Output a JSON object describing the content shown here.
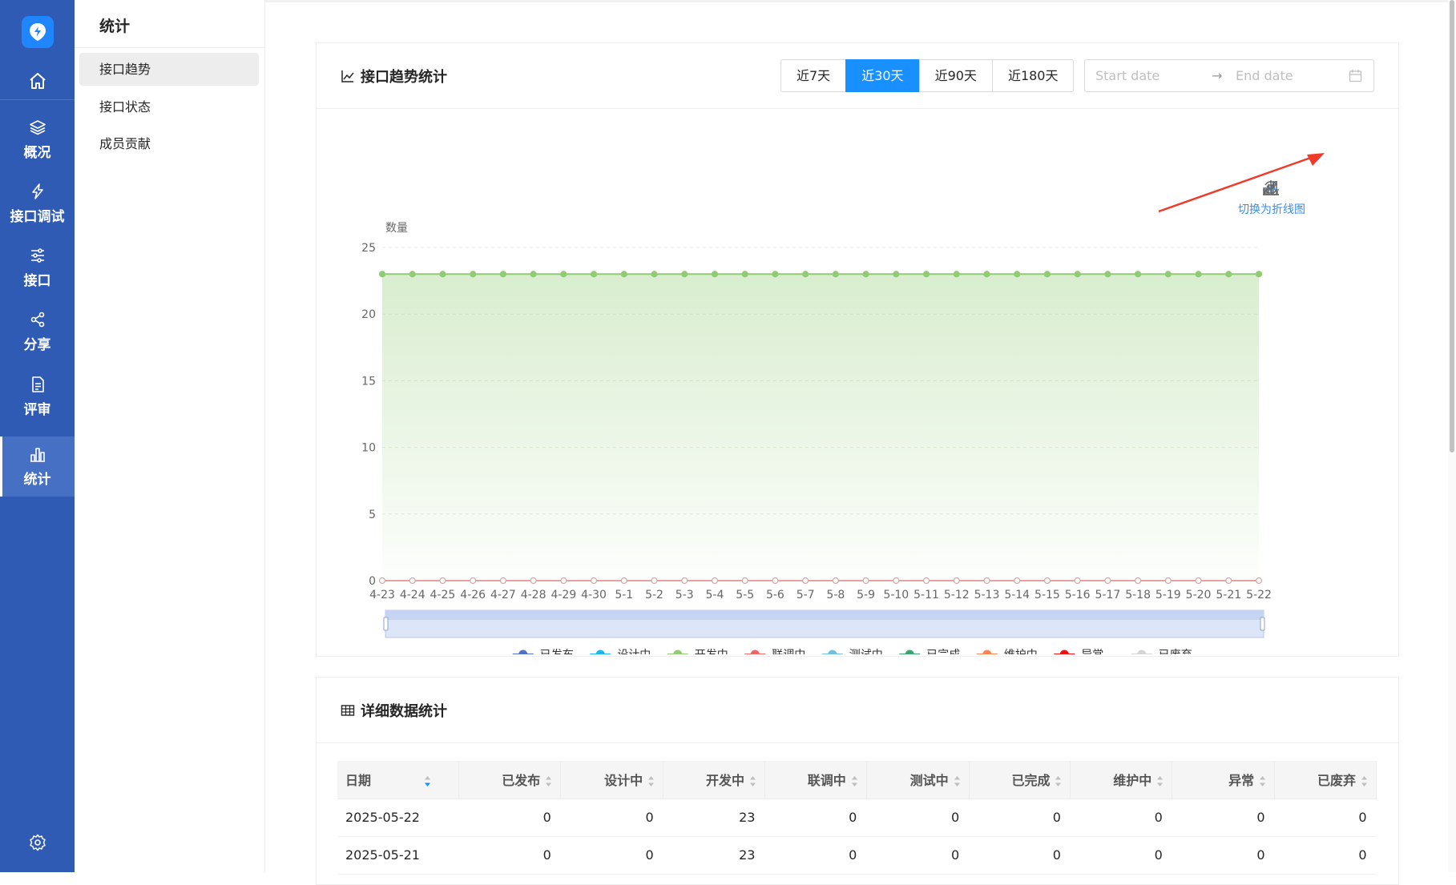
{
  "rail": {
    "items": [
      {
        "name": "home",
        "label": ""
      },
      {
        "name": "overview",
        "label": "概况"
      },
      {
        "name": "api-debug",
        "label": "接口调试"
      },
      {
        "name": "api",
        "label": "接口"
      },
      {
        "name": "share",
        "label": "分享"
      },
      {
        "name": "review",
        "label": "评审"
      },
      {
        "name": "stats",
        "label": "统计"
      }
    ]
  },
  "submenu": {
    "title": "统计",
    "items": [
      "接口趋势",
      "接口状态",
      "成员贡献"
    ]
  },
  "trend_card": {
    "title": "接口趋势统计",
    "ranges": [
      "近7天",
      "近30天",
      "近90天",
      "近180天"
    ],
    "active_range": "近30天",
    "date_start_placeholder": "Start date",
    "date_end_placeholder": "End date",
    "date_separator": "→",
    "toolbox_tip": "切换为折线图"
  },
  "chart_data": {
    "type": "area",
    "title": "",
    "xlabel": "",
    "ylabel": "数量",
    "ylim": [
      0,
      25
    ],
    "yticks": [
      0,
      5,
      10,
      15,
      20,
      25
    ],
    "grid": true,
    "legend_position": "bottom",
    "categories": [
      "4-23",
      "4-24",
      "4-25",
      "4-26",
      "4-27",
      "4-28",
      "4-29",
      "4-30",
      "5-1",
      "5-2",
      "5-3",
      "5-4",
      "5-5",
      "5-6",
      "5-7",
      "5-8",
      "5-9",
      "5-10",
      "5-11",
      "5-12",
      "5-13",
      "5-14",
      "5-15",
      "5-16",
      "5-17",
      "5-18",
      "5-19",
      "5-20",
      "5-21",
      "5-22"
    ],
    "series": [
      {
        "name": "已发布",
        "color": "#5470c6",
        "values": [
          0,
          0,
          0,
          0,
          0,
          0,
          0,
          0,
          0,
          0,
          0,
          0,
          0,
          0,
          0,
          0,
          0,
          0,
          0,
          0,
          0,
          0,
          0,
          0,
          0,
          0,
          0,
          0,
          0,
          0
        ]
      },
      {
        "name": "设计中",
        "color": "#19b7f0",
        "values": [
          0,
          0,
          0,
          0,
          0,
          0,
          0,
          0,
          0,
          0,
          0,
          0,
          0,
          0,
          0,
          0,
          0,
          0,
          0,
          0,
          0,
          0,
          0,
          0,
          0,
          0,
          0,
          0,
          0,
          0
        ]
      },
      {
        "name": "开发中",
        "color": "#91cc75",
        "values": [
          23,
          23,
          23,
          23,
          23,
          23,
          23,
          23,
          23,
          23,
          23,
          23,
          23,
          23,
          23,
          23,
          23,
          23,
          23,
          23,
          23,
          23,
          23,
          23,
          23,
          23,
          23,
          23,
          23,
          23
        ]
      },
      {
        "name": "联调中",
        "color": "#ee6666",
        "values": [
          0,
          0,
          0,
          0,
          0,
          0,
          0,
          0,
          0,
          0,
          0,
          0,
          0,
          0,
          0,
          0,
          0,
          0,
          0,
          0,
          0,
          0,
          0,
          0,
          0,
          0,
          0,
          0,
          0,
          0
        ]
      },
      {
        "name": "测试中",
        "color": "#73c0de",
        "values": [
          0,
          0,
          0,
          0,
          0,
          0,
          0,
          0,
          0,
          0,
          0,
          0,
          0,
          0,
          0,
          0,
          0,
          0,
          0,
          0,
          0,
          0,
          0,
          0,
          0,
          0,
          0,
          0,
          0,
          0
        ]
      },
      {
        "name": "已完成",
        "color": "#3ba272",
        "values": [
          0,
          0,
          0,
          0,
          0,
          0,
          0,
          0,
          0,
          0,
          0,
          0,
          0,
          0,
          0,
          0,
          0,
          0,
          0,
          0,
          0,
          0,
          0,
          0,
          0,
          0,
          0,
          0,
          0,
          0
        ]
      },
      {
        "name": "维护中",
        "color": "#fc8452",
        "values": [
          0,
          0,
          0,
          0,
          0,
          0,
          0,
          0,
          0,
          0,
          0,
          0,
          0,
          0,
          0,
          0,
          0,
          0,
          0,
          0,
          0,
          0,
          0,
          0,
          0,
          0,
          0,
          0,
          0,
          0
        ]
      },
      {
        "name": "异常",
        "color": "#ee1111",
        "values": [
          0,
          0,
          0,
          0,
          0,
          0,
          0,
          0,
          0,
          0,
          0,
          0,
          0,
          0,
          0,
          0,
          0,
          0,
          0,
          0,
          0,
          0,
          0,
          0,
          0,
          0,
          0,
          0,
          0,
          0
        ]
      },
      {
        "name": "已废弃",
        "color": "#d5d5d5",
        "values": [
          0,
          0,
          0,
          0,
          0,
          0,
          0,
          0,
          0,
          0,
          0,
          0,
          0,
          0,
          0,
          0,
          0,
          0,
          0,
          0,
          0,
          0,
          0,
          0,
          0,
          0,
          0,
          0,
          0,
          0
        ]
      }
    ]
  },
  "detail_card": {
    "title": "详细数据统计",
    "columns": [
      "日期",
      "已发布",
      "设计中",
      "开发中",
      "联调中",
      "测试中",
      "已完成",
      "维护中",
      "异常",
      "已废弃"
    ],
    "rows": [
      [
        "2025-05-22",
        "0",
        "0",
        "23",
        "0",
        "0",
        "0",
        "0",
        "0",
        "0"
      ],
      [
        "2025-05-21",
        "0",
        "0",
        "23",
        "0",
        "0",
        "0",
        "0",
        "0",
        "0"
      ]
    ]
  },
  "colors": {
    "rail_bg": "#2f5bb5",
    "accent": "#1890ff",
    "annotation_arrow": "#f03a2a"
  }
}
